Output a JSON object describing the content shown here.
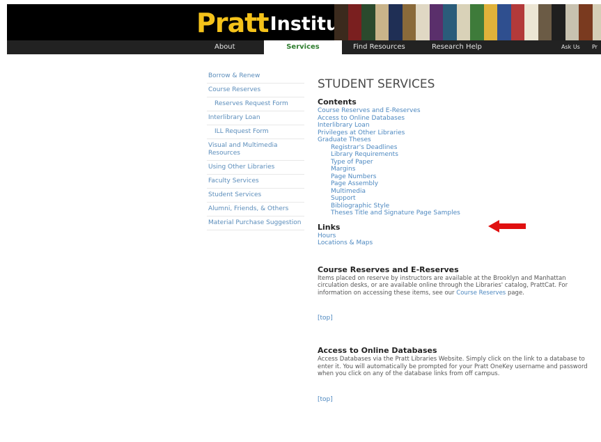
{
  "header": {
    "logo_pratt": "Pratt",
    "logo_rest": "Institute Libraries",
    "spine_colors": [
      "#3b2a1d",
      "#7a1f1f",
      "#2b4a2d",
      "#c9b48a",
      "#1f2f55",
      "#8a6a3a",
      "#e0d8c4",
      "#5a2f6b",
      "#2a5c7a",
      "#d9d2b8",
      "#3e7b3a",
      "#e0b23a",
      "#2f4f8f",
      "#b33a3a",
      "#ece6d4",
      "#6b5b45",
      "#1f1f1f",
      "#c8c2b0",
      "#7a3a1f",
      "#d5ceb6"
    ]
  },
  "nav": {
    "about": "About",
    "services": "Services",
    "find_resources": "Find Resources",
    "research_help": "Research Help",
    "ask_us": "Ask Us",
    "pr": "Pr"
  },
  "sidebar": {
    "items": [
      {
        "label": "Borrow & Renew"
      },
      {
        "label": "Course Reserves"
      },
      {
        "label": "Reserves Request Form"
      },
      {
        "label": "Interlibrary Loan"
      },
      {
        "label": "ILL Request Form"
      },
      {
        "label": "Visual and Multimedia Resources"
      },
      {
        "label": "Using Other Libraries"
      },
      {
        "label": "Faculty Services"
      },
      {
        "label": "Student Services"
      },
      {
        "label": "Alumni, Friends, & Others"
      },
      {
        "label": "Material Purchase Suggestion"
      }
    ]
  },
  "main": {
    "title": "STUDENT SERVICES",
    "contents_heading": "Contents",
    "toc": [
      {
        "label": "Course Reserves and E-Reserves"
      },
      {
        "label": "Access to Online Databases"
      },
      {
        "label": "Interlibrary Loan"
      },
      {
        "label": "Privileges at Other Libraries"
      },
      {
        "label": "Graduate Theses"
      },
      {
        "label": "Registrar's Deadlines"
      },
      {
        "label": "Library Requirements"
      },
      {
        "label": "Type of Paper"
      },
      {
        "label": "Margins"
      },
      {
        "label": "Page Numbers"
      },
      {
        "label": "Page Assembly"
      },
      {
        "label": "Multimedia"
      },
      {
        "label": "Support"
      },
      {
        "label": "Bibliographic Style"
      },
      {
        "label": "Theses Title and Signature Page Samples"
      }
    ],
    "links_heading": "Links",
    "links": [
      {
        "label": "Hours"
      },
      {
        "label": "Locations & Maps"
      }
    ],
    "sections": [
      {
        "heading": "Course Reserves and E-Reserves",
        "text_before": "Items placed on reserve by instructors are available at the Brooklyn and Manhattan circulation desks, or are available online through the Libraries' catalog, PrattCat.  For information on accessing these items, see our ",
        "link": "Course Reserves",
        "text_after": " page.",
        "top": "[top]"
      },
      {
        "heading": "Access to Online Databases",
        "text_before": "Access Databases via the Pratt Libraries Website. Simply click on the link to a database to enter it. You will automatically be prompted for your Pratt OneKey username and password when you click on any of the database links from off campus.",
        "top": "[top]"
      }
    ]
  },
  "annotation": {
    "arrow_color": "#e01010"
  }
}
